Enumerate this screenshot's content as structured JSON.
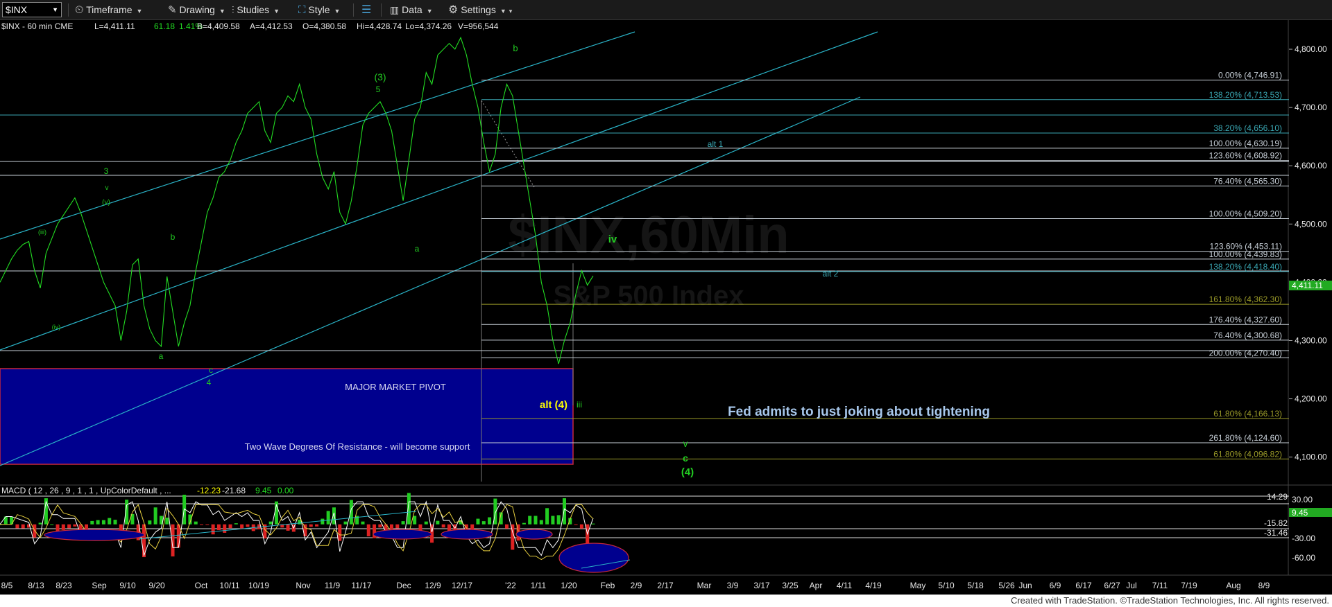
{
  "toolbar": {
    "symbol": "$INX",
    "timeframe": "Timeframe",
    "drawing": "Drawing",
    "studies": "Studies",
    "style": "Style",
    "data": "Data",
    "settings": "Settings"
  },
  "header": {
    "symbol_info": "$INX - 60 min  CME",
    "last": "L=4,411.11",
    "change": "61.18",
    "pct": "1.41%",
    "bid": "B=4,409.58",
    "ask": "A=4,412.53",
    "open": "O=4,380.58",
    "high": "Hi=4,428.74",
    "low": "Lo=4,374.26",
    "volume": "V=956,544"
  },
  "watermark": {
    "line1": "$INX,60Min",
    "line2": "S&P 500 Index"
  },
  "colors": {
    "price": "#22dd22",
    "channel": "#2ab4c8",
    "fib_white": "#c8d0d8",
    "fib_teal": "#3aa8b4",
    "fib_olive": "#9a9a28",
    "pivot_fill": "#00008e",
    "pivot_border": "#c8283c",
    "wave_green": "#22cc22",
    "wave_yellow": "#ffff00"
  },
  "chart_data": [
    {
      "type": "line",
      "title": "$INX - 60 min",
      "y_axis_ticks": [
        4800,
        4700,
        4600,
        4500,
        4400,
        4300,
        4200,
        4100
      ],
      "y_axis_labels": [
        "4,800.00",
        "4,700.00",
        "4,600.00",
        "4,500.00",
        "4,400.00",
        "4,300.00",
        "4,200.00",
        "4,100.00"
      ],
      "ylim": [
        4052,
        4850
      ],
      "last_price_label": "4,411.11",
      "x_axis_labels": [
        "8/5",
        "8/13",
        "8/23",
        "Sep",
        "9/10",
        "9/20",
        "Oct",
        "10/11",
        "10/19",
        "Nov",
        "11/9",
        "11/17",
        "Dec",
        "12/9",
        "12/17",
        "'22",
        "1/11",
        "1/20",
        "Feb",
        "2/9",
        "2/17",
        "Mar",
        "3/9",
        "3/17",
        "3/25",
        "Apr",
        "4/11",
        "4/19",
        "May",
        "5/10",
        "5/18",
        "5/26",
        "Jun",
        "6/9",
        "6/17",
        "6/27",
        "Jul",
        "7/11",
        "7/19",
        "Aug",
        "8/9"
      ],
      "series": [
        {
          "values": [
            4400,
            4420,
            4440,
            4455,
            4465,
            4470,
            4420,
            4390,
            4450,
            4475,
            4500,
            4515,
            4530,
            4545,
            4520,
            4490,
            4460,
            4430,
            4400,
            4380,
            4360,
            4300,
            4350,
            4430,
            4440,
            4360,
            4320,
            4300,
            4290,
            4410,
            4350,
            4290,
            4330,
            4360,
            4420,
            4470,
            4520,
            4545,
            4580,
            4590,
            4610,
            4640,
            4660,
            4690,
            4700,
            4710,
            4660,
            4640,
            4690,
            4700,
            4720,
            4710,
            4740,
            4700,
            4680,
            4620,
            4580,
            4560,
            4590,
            4520,
            4500,
            4540,
            4600,
            4670,
            4690,
            4700,
            4710,
            4690,
            4660,
            4600,
            4540,
            4610,
            4680,
            4700,
            4760,
            4740,
            4790,
            4800,
            4810,
            4800,
            4820,
            4790,
            4740,
            4700,
            4640,
            4590,
            4620,
            4700,
            4740,
            4720,
            4660,
            4600,
            4540,
            4480,
            4400,
            4360,
            4300,
            4260,
            4300,
            4330,
            4380,
            4420,
            4395,
            4411
          ]
        }
      ],
      "fib_levels": [
        {
          "label": "0.00% (4,746.91)",
          "value": 4746.91
        },
        {
          "label": "138.20% (4,713.53)",
          "value": 4713.53
        },
        {
          "label": "38.20% (4,656.10)",
          "value": 4656.1
        },
        {
          "label": "100.00% (4,630.19)",
          "value": 4630.19
        },
        {
          "label": "123.60% (4,608.92)",
          "value": 4608.92
        },
        {
          "label": "76.40% (4,565.30)",
          "value": 4565.3
        },
        {
          "label": "100.00% (4,509.20)",
          "value": 4509.2
        },
        {
          "label": "123.60% (4,453.11)",
          "value": 4453.11
        },
        {
          "label": "100.00% (4,439.83)",
          "value": 4439.83
        },
        {
          "label": "138.20% (4,418.40)",
          "value": 4418.4
        },
        {
          "label": "161.80% (4,362.30)",
          "value": 4362.3
        },
        {
          "label": "176.40% (4,327.60)",
          "value": 4327.6
        },
        {
          "label": "76.40% (4,300.68)",
          "value": 4300.68
        },
        {
          "label": "200.00% (4,270.40)",
          "value": 4270.4
        },
        {
          "label": "61.80% (4,166.13)",
          "value": 4166.13
        },
        {
          "label": "261.80% (4,124.60)",
          "value": 4124.6
        },
        {
          "label": "61.80% (4,096.82)",
          "value": 4096.82
        }
      ],
      "annotations": {
        "pivot_title": "MAJOR MARKET PIVOT",
        "pivot_note": "Two Wave Degrees Of Resistance - will become support",
        "alt4": "alt (4)",
        "headline": "Fed admits to just joking about tightening",
        "alt1": "alt 1",
        "alt2": "alt 2",
        "waves": [
          "(3)",
          "5",
          "b",
          "a",
          "3",
          "v",
          "(v)",
          "(iii)",
          "(iv)",
          "b",
          "a",
          "c",
          "4",
          "iv",
          "iii",
          "v",
          "c",
          "(4)"
        ]
      }
    },
    {
      "type": "line",
      "title": "MACD ( 12 , 26 , 9 , 1 , 1 , UpColorDefault , ...",
      "values_text": [
        "-12.23",
        "-21.68",
        "9.45",
        "0.00"
      ],
      "y_axis_labels": [
        "30.00",
        "-30.00",
        "-60.00"
      ],
      "ref_levels": [
        "14.29",
        "-15.82",
        "-31.46"
      ],
      "last_value_label": "9.45",
      "ylim": [
        -72,
        40
      ]
    }
  ],
  "footer": "Created with TradeStation. ©TradeStation Technologies, Inc. All rights reserved."
}
